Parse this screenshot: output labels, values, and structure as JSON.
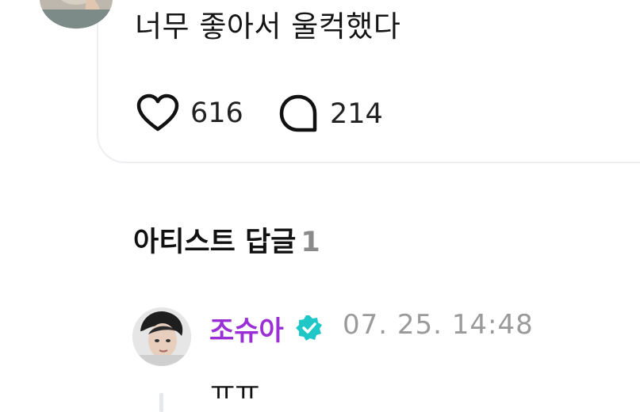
{
  "post": {
    "text": "너무 좋아서 울컥했다",
    "likes": "616",
    "comments": "214"
  },
  "artist_section": {
    "title": "아티스트 답글",
    "count": "1"
  },
  "reply": {
    "name": "조슈아",
    "time": "07. 25. 14:48",
    "text": "ㅠㅠ"
  },
  "colors": {
    "accent_name": "#9b2fd6",
    "verified_badge": "#1fc7c7",
    "card_border": "#eceef2"
  },
  "icons": {
    "like": "heart-icon",
    "comment": "comment-bubble-icon",
    "verified": "verified-badge-icon"
  }
}
